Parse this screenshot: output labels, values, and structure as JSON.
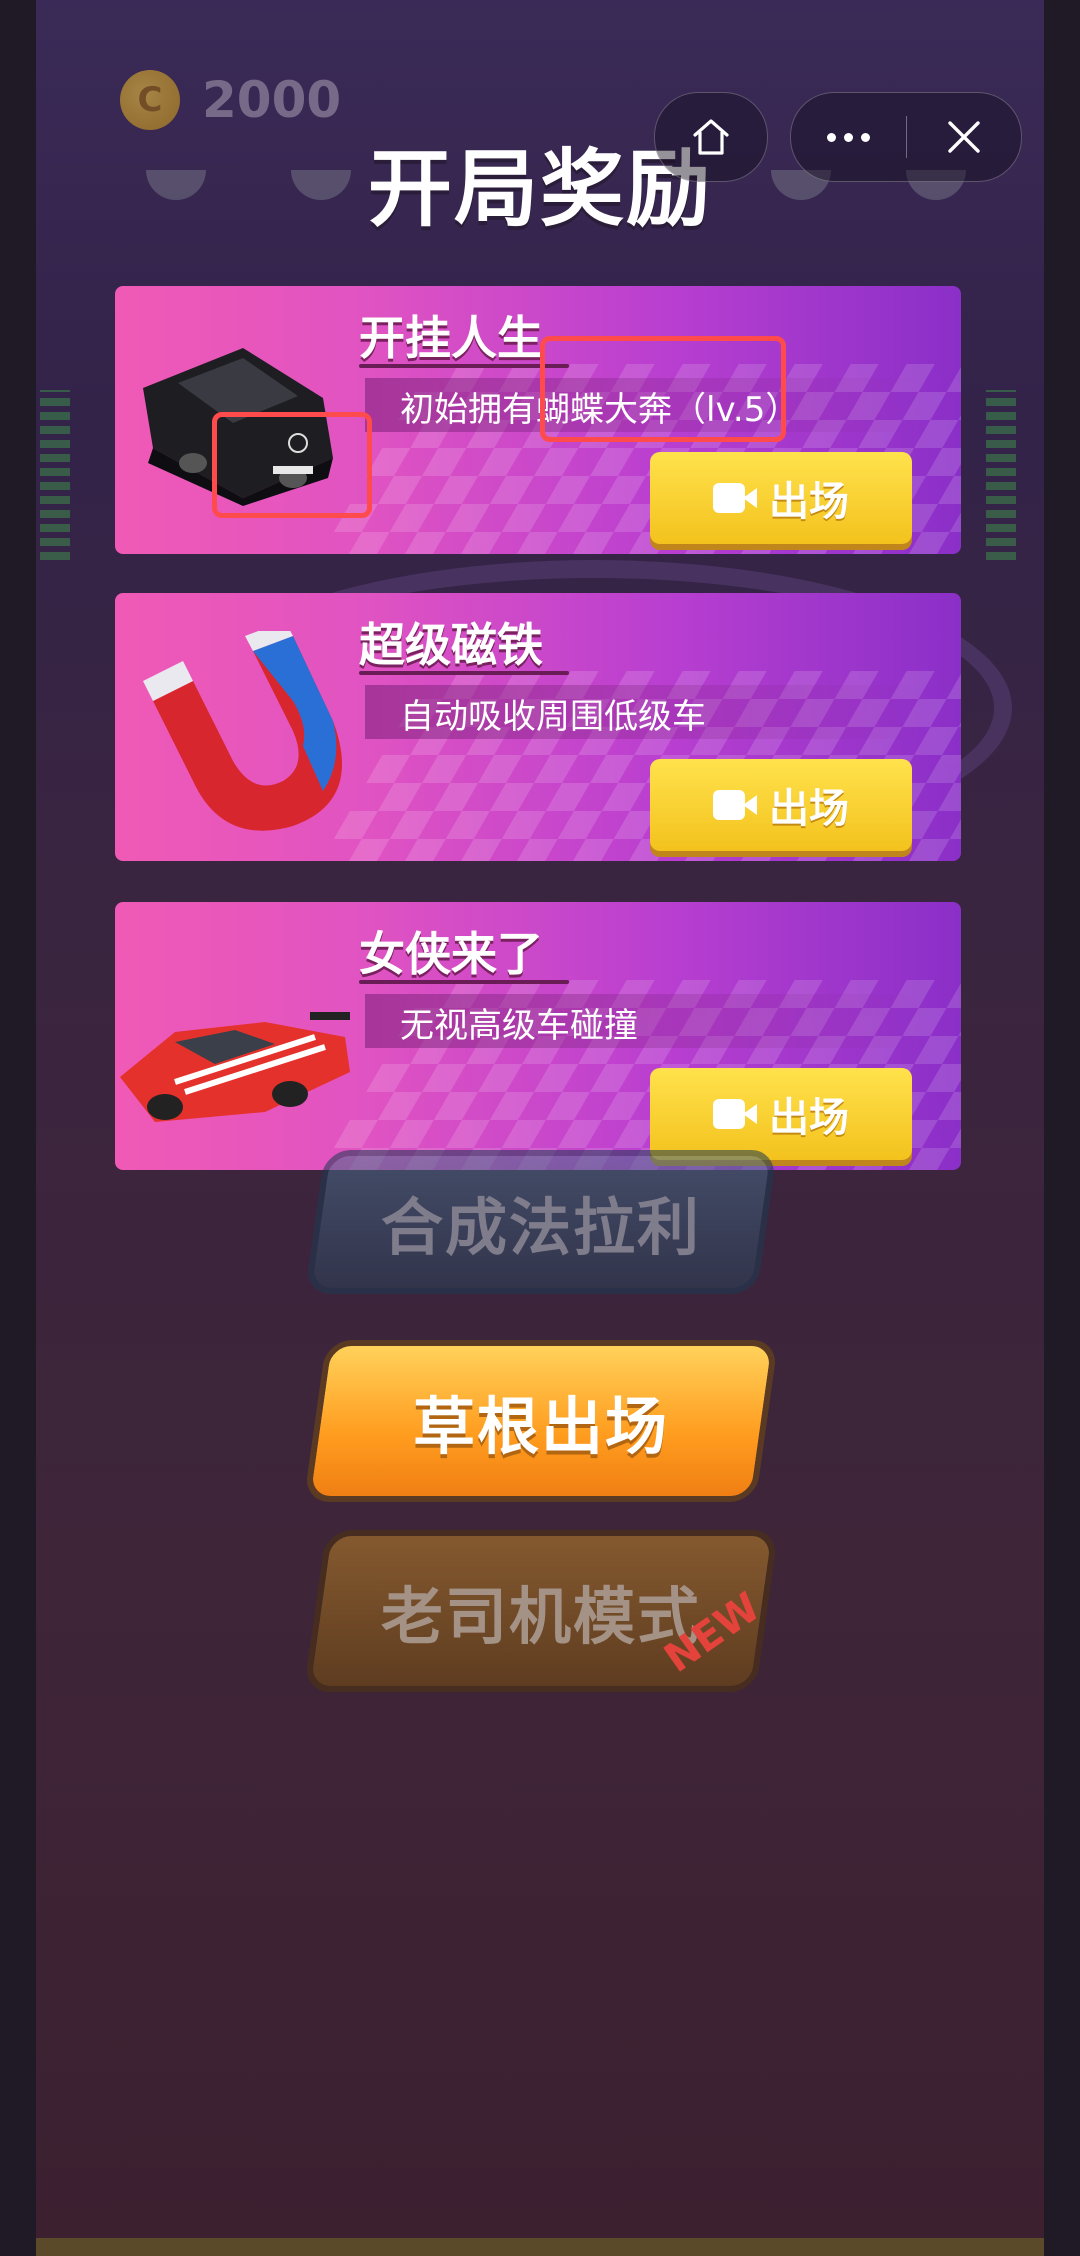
{
  "header": {
    "coin_symbol": "C",
    "coin_amount": "2000",
    "title": "开局奖励"
  },
  "capsule": {
    "home_icon": "home-icon",
    "more_icon": "more-dots-icon",
    "close_icon": "close-icon"
  },
  "cards": [
    {
      "name": "开挂人生",
      "desc": "初始拥有蝴蝶大奔（lv.5）",
      "button": "出场",
      "icon": "black-sedan-car"
    },
    {
      "name": "超级磁铁",
      "desc": "自动吸收周围低级车",
      "button": "出场",
      "icon": "horseshoe-magnet"
    },
    {
      "name": "女侠来了",
      "desc": "无视高级车碰撞",
      "button": "出场",
      "icon": "red-sports-car"
    }
  ],
  "menu": {
    "merge_label": "合成法拉利",
    "start_label": "草根出场",
    "veteran_label": "老司机模式",
    "new_tag": "NEW"
  },
  "colors": {
    "card_pink": "#f05ab6",
    "card_purple": "#8a2fc8",
    "button_yellow": "#f3c21d",
    "highlight_red": "#ff4b4b"
  }
}
